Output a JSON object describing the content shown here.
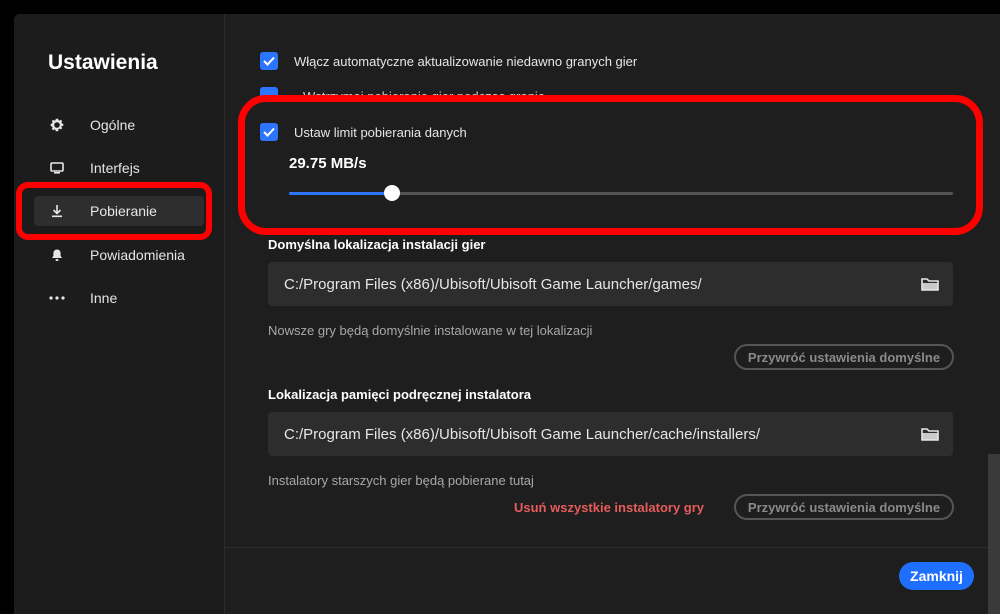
{
  "sidebar": {
    "title": "Ustawienia",
    "items": [
      {
        "label": "Ogólne",
        "icon": "gear-icon"
      },
      {
        "label": "Interfejs",
        "icon": "monitor-icon"
      },
      {
        "label": "Pobieranie",
        "icon": "download-icon",
        "active": true
      },
      {
        "label": "Powiadomienia",
        "icon": "bell-icon"
      },
      {
        "label": "Inne",
        "icon": "more-icon"
      }
    ]
  },
  "downloads": {
    "auto_update_label": "Włącz automatyczne aktualizowanie niedawno granych gier",
    "pause_label": "Wstrzymaj pobieranie gier podczas grania",
    "limit_label": "Ustaw limit pobierania danych",
    "limit_value": "29.75 MB/s",
    "limit_slider_fraction": 0.155,
    "install_location": {
      "label": "Domyślna lokalizacja instalacji gier",
      "path": "C:/Program Files (x86)/Ubisoft/Ubisoft Game Launcher/games/",
      "helper": "Nowsze gry będą domyślnie instalowane w tej lokalizacji",
      "reset_label": "Przywróć ustawienia domyślne"
    },
    "cache_location": {
      "label": "Lokalizacja pamięci podręcznej instalatora",
      "path": "C:/Program Files (x86)/Ubisoft/Ubisoft Game Launcher/cache/installers/",
      "helper": "Instalatory starszych gier będą pobierane tutaj",
      "delete_label": "Usuń wszystkie instalatory gry",
      "reset_label": "Przywróć ustawienia domyślne"
    }
  },
  "footer": {
    "close_label": "Zamknij"
  },
  "colors": {
    "accent": "#2c75ff",
    "highlight": "#ff0000",
    "danger": "#e65c5c"
  }
}
